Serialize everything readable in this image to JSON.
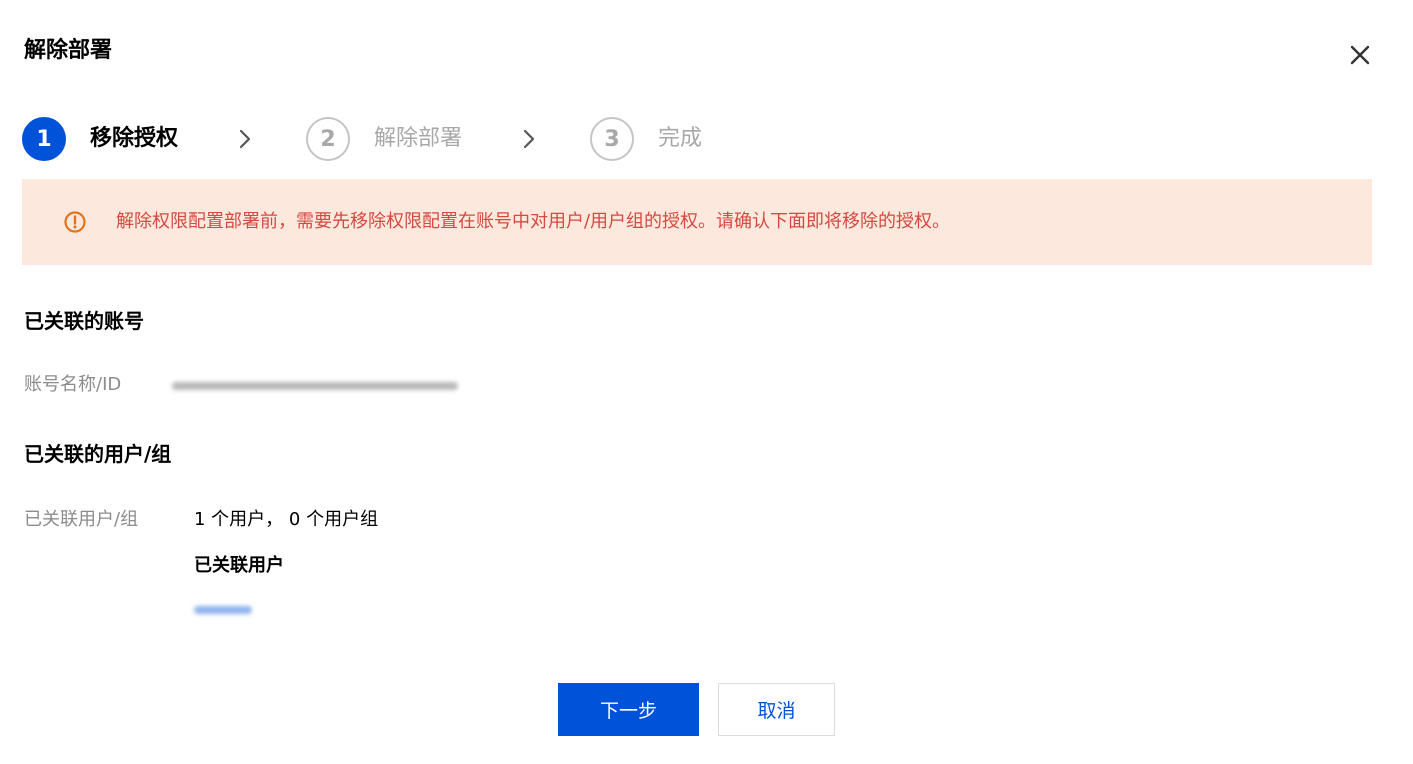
{
  "dialog": {
    "title": "解除部署",
    "close_icon": "close-icon"
  },
  "steps": [
    {
      "number": "1",
      "label": "移除授权",
      "state": "active"
    },
    {
      "number": "2",
      "label": "解除部署",
      "state": "pending"
    },
    {
      "number": "3",
      "label": "完成",
      "state": "pending"
    }
  ],
  "notice": {
    "icon": "warning-circle-icon",
    "text": "解除权限配置部署前，需要先移除权限配置在账号中对用户/用户组的授权。请确认下面即将移除的授权。"
  },
  "account_section": {
    "title": "已关联的账号",
    "field_label": "账号名称/ID"
  },
  "users_section": {
    "title": "已关联的用户/组",
    "field_label": "已关联用户/组",
    "summary": "1 个用户， 0 个用户组",
    "users_heading": "已关联用户"
  },
  "footer": {
    "next_label": "下一步",
    "cancel_label": "取消"
  },
  "colors": {
    "primary": "#0052d9",
    "notice_bg": "#fde8dd",
    "notice_text": "#d54941",
    "warning_icon": "#e37318",
    "muted": "#a8a8a8"
  }
}
